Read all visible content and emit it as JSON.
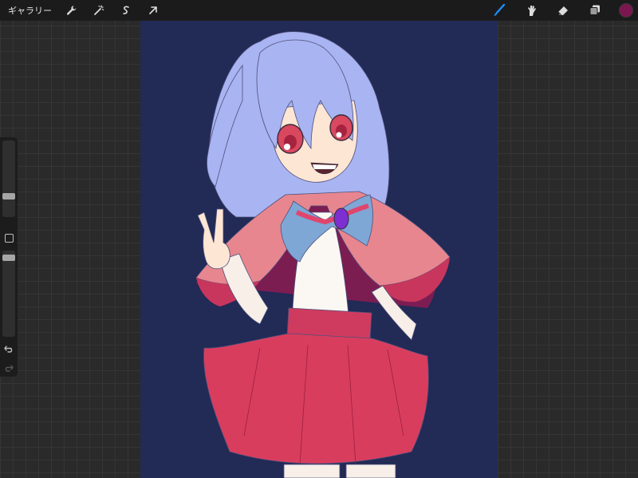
{
  "topbar": {
    "gallery_label": "ギャラリー",
    "left_tools": [
      "wrench-icon",
      "magic-wand-icon",
      "selection-icon",
      "transform-arrow-icon"
    ],
    "right_tools": [
      "brush-icon",
      "smudge-icon",
      "eraser-icon",
      "layers-icon"
    ],
    "active_tool": "brush-icon",
    "current_color": "#7a1650",
    "accent_color": "#1f8fff"
  },
  "canvas": {
    "background_color": "#222a56",
    "subject": "anime-girl-illustration"
  },
  "sidebar": {
    "size_level": 0.25,
    "opacity_level": 0.95
  }
}
